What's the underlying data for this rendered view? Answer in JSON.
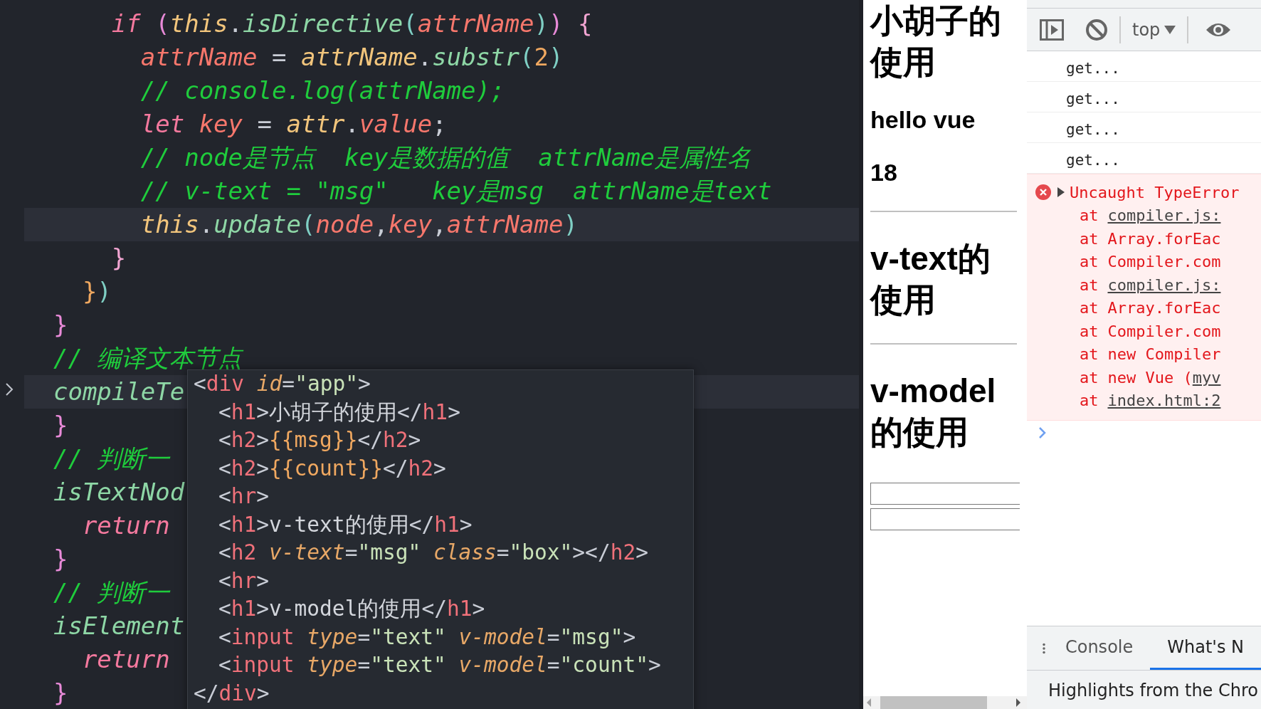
{
  "editor": {
    "lines": [
      {
        "children": [
          {
            "children": [
              {
                "highlighted": false,
                "tokens": [
                  {
                    "t": "if",
                    "kind": "kw"
                  },
                  {
                    "t": " (",
                    "kind": "br"
                  },
                  {
                    "t": "this",
                    "kind": "obj"
                  },
                  {
                    "t": ".",
                    "kind": "p"
                  },
                  {
                    "t": "isDirective",
                    "kind": "fn"
                  },
                  {
                    "t": "(",
                    "kind": "br2"
                  },
                  {
                    "t": "attrName",
                    "kind": "var"
                  },
                  {
                    "t": ")",
                    "kind": "br2"
                  },
                  {
                    "t": ")",
                    "kind": "br"
                  },
                  {
                    "t": " {",
                    "kind": "br3"
                  }
                ],
                "children": [
                  {
                    "highlighted": false,
                    "tokens": [
                      {
                        "t": "attrName",
                        "kind": "var"
                      },
                      {
                        "t": " = ",
                        "kind": "p"
                      },
                      {
                        "t": "attrName",
                        "kind": "obj"
                      },
                      {
                        "t": ".",
                        "kind": "p"
                      },
                      {
                        "t": "substr",
                        "kind": "fn"
                      },
                      {
                        "t": "(",
                        "kind": "br2"
                      },
                      {
                        "t": "2",
                        "kind": "num"
                      },
                      {
                        "t": ")",
                        "kind": "br2"
                      }
                    ]
                  },
                  {
                    "highlighted": false,
                    "tokens": [
                      {
                        "t": "// console.log(attrName);",
                        "kind": "cm"
                      }
                    ]
                  },
                  {
                    "highlighted": false,
                    "tokens": [
                      {
                        "t": "let ",
                        "kind": "kw"
                      },
                      {
                        "t": "key",
                        "kind": "var"
                      },
                      {
                        "t": " = ",
                        "kind": "p"
                      },
                      {
                        "t": "attr",
                        "kind": "obj"
                      },
                      {
                        "t": ".",
                        "kind": "p"
                      },
                      {
                        "t": "value",
                        "kind": "var"
                      },
                      {
                        "t": ";",
                        "kind": "p"
                      }
                    ]
                  },
                  {
                    "highlighted": false,
                    "tokens": [
                      {
                        "t": "// node是节点  key是数据的值  attrName是属性名",
                        "kind": "cm"
                      }
                    ]
                  },
                  {
                    "highlighted": false,
                    "tokens": [
                      {
                        "t": "// v-text = \"msg\"   key是msg  attrName是text",
                        "kind": "cm"
                      }
                    ]
                  },
                  {
                    "highlighted": true,
                    "tokens": [
                      {
                        "t": "this",
                        "kind": "obj"
                      },
                      {
                        "t": ".",
                        "kind": "p"
                      },
                      {
                        "t": "update",
                        "kind": "fn"
                      },
                      {
                        "t": "(",
                        "kind": "br2"
                      },
                      {
                        "t": "node",
                        "kind": "var"
                      },
                      {
                        "t": ",",
                        "kind": "p"
                      },
                      {
                        "t": "key",
                        "kind": "var"
                      },
                      {
                        "t": ",",
                        "kind": "p"
                      },
                      {
                        "t": "attrName",
                        "kind": "var"
                      },
                      {
                        "t": ")",
                        "kind": "br2"
                      }
                    ]
                  }
                ]
              },
              {
                "highlighted": false,
                "tokens": [
                  {
                    "t": "}",
                    "kind": "br3"
                  }
                ]
              }
            ]
          },
          {
            "highlighted": false,
            "tokens": [
              {
                "t": "}",
                "kind": "num"
              },
              {
                "t": ")",
                "kind": "br2"
              }
            ]
          }
        ]
      },
      {
        "highlighted": false,
        "tokens": [
          {
            "t": "}",
            "kind": "br"
          }
        ]
      },
      {
        "highlighted": false,
        "tokens": [
          {
            "t": "// 编译文本节点",
            "kind": "cm"
          }
        ]
      },
      {
        "highlighted": true,
        "tokens": [
          {
            "t": "compileTe",
            "kind": "fn"
          }
        ]
      },
      {
        "highlighted": false,
        "tokens": [
          {
            "t": "}",
            "kind": "br"
          }
        ]
      },
      {
        "highlighted": false,
        "tokens": [
          {
            "t": "// 判断一",
            "kind": "cm"
          }
        ]
      },
      {
        "highlighted": false,
        "tokens": [
          {
            "t": "isTextNod",
            "kind": "fn"
          }
        ],
        "children": [
          {
            "highlighted": false,
            "tokens": [
              {
                "t": "return",
                "kind": "kw"
              }
            ]
          }
        ]
      },
      {
        "highlighted": false,
        "tokens": [
          {
            "t": "}",
            "kind": "br"
          }
        ]
      },
      {
        "highlighted": false,
        "tokens": [
          {
            "t": "// 判断一",
            "kind": "cm"
          }
        ]
      },
      {
        "highlighted": false,
        "tokens": [
          {
            "t": "isElement",
            "kind": "fn"
          }
        ],
        "children": [
          {
            "highlighted": false,
            "tokens": [
              {
                "t": "return",
                "kind": "kw"
              }
            ]
          }
        ]
      },
      {
        "highlighted": false,
        "tokens": [
          {
            "t": "}",
            "kind": "br"
          }
        ]
      }
    ]
  },
  "html_popup": {
    "lines": [
      {
        "tokens": [
          {
            "t": "<",
            "kind": "p"
          },
          {
            "t": "div",
            "kind": "tag"
          },
          {
            "t": " id",
            "kind": "attr"
          },
          {
            "t": "=",
            "kind": "p"
          },
          {
            "t": "\"app\"",
            "kind": "str"
          },
          {
            "t": ">",
            "kind": "p"
          }
        ],
        "children": [
          {
            "tokens": [
              {
                "t": "<",
                "kind": "p"
              },
              {
                "t": "h1",
                "kind": "tag"
              },
              {
                "t": ">",
                "kind": "p"
              },
              {
                "t": "小胡子的使用",
                "kind": "txt"
              },
              {
                "t": "</",
                "kind": "p"
              },
              {
                "t": "h1",
                "kind": "tag"
              },
              {
                "t": ">",
                "kind": "p"
              }
            ]
          },
          {
            "tokens": [
              {
                "t": "<",
                "kind": "p"
              },
              {
                "t": "h2",
                "kind": "tag"
              },
              {
                "t": ">",
                "kind": "p"
              },
              {
                "t": "{{msg}}",
                "kind": "interp"
              },
              {
                "t": "</",
                "kind": "p"
              },
              {
                "t": "h2",
                "kind": "tag"
              },
              {
                "t": ">",
                "kind": "p"
              }
            ]
          },
          {
            "tokens": [
              {
                "t": "<",
                "kind": "p"
              },
              {
                "t": "h2",
                "kind": "tag"
              },
              {
                "t": ">",
                "kind": "p"
              },
              {
                "t": "{{count}}",
                "kind": "interp"
              },
              {
                "t": "</",
                "kind": "p"
              },
              {
                "t": "h2",
                "kind": "tag"
              },
              {
                "t": ">",
                "kind": "p"
              }
            ]
          },
          {
            "tokens": [
              {
                "t": "<",
                "kind": "p"
              },
              {
                "t": "hr",
                "kind": "tag"
              },
              {
                "t": ">",
                "kind": "p"
              }
            ]
          },
          {
            "tokens": [
              {
                "t": "<",
                "kind": "p"
              },
              {
                "t": "h1",
                "kind": "tag"
              },
              {
                "t": ">",
                "kind": "p"
              },
              {
                "t": "v-text的使用",
                "kind": "txt"
              },
              {
                "t": "</",
                "kind": "p"
              },
              {
                "t": "h1",
                "kind": "tag"
              },
              {
                "t": ">",
                "kind": "p"
              }
            ]
          },
          {
            "tokens": [
              {
                "t": "<",
                "kind": "p"
              },
              {
                "t": "h2",
                "kind": "tag"
              },
              {
                "t": " v-text",
                "kind": "attr"
              },
              {
                "t": "=",
                "kind": "p"
              },
              {
                "t": "\"msg\"",
                "kind": "str"
              },
              {
                "t": " class",
                "kind": "attr"
              },
              {
                "t": "=",
                "kind": "p"
              },
              {
                "t": "\"box\"",
                "kind": "str"
              },
              {
                "t": "></",
                "kind": "p"
              },
              {
                "t": "h2",
                "kind": "tag"
              },
              {
                "t": ">",
                "kind": "p"
              }
            ]
          },
          {
            "tokens": [
              {
                "t": "<",
                "kind": "p"
              },
              {
                "t": "hr",
                "kind": "tag"
              },
              {
                "t": ">",
                "kind": "p"
              }
            ]
          },
          {
            "tokens": [
              {
                "t": "<",
                "kind": "p"
              },
              {
                "t": "h1",
                "kind": "tag"
              },
              {
                "t": ">",
                "kind": "p"
              },
              {
                "t": "v-model的使用",
                "kind": "txt"
              },
              {
                "t": "</",
                "kind": "p"
              },
              {
                "t": "h1",
                "kind": "tag"
              },
              {
                "t": ">",
                "kind": "p"
              }
            ]
          },
          {
            "tokens": [
              {
                "t": "<",
                "kind": "p"
              },
              {
                "t": "input",
                "kind": "tag"
              },
              {
                "t": " type",
                "kind": "attr"
              },
              {
                "t": "=",
                "kind": "p"
              },
              {
                "t": "\"text\"",
                "kind": "str"
              },
              {
                "t": " v-model",
                "kind": "attr"
              },
              {
                "t": "=",
                "kind": "p"
              },
              {
                "t": "\"msg\"",
                "kind": "str"
              },
              {
                "t": ">",
                "kind": "p"
              }
            ]
          },
          {
            "tokens": [
              {
                "t": "<",
                "kind": "p"
              },
              {
                "t": "input",
                "kind": "tag"
              },
              {
                "t": " type",
                "kind": "attr"
              },
              {
                "t": "=",
                "kind": "p"
              },
              {
                "t": "\"text\"",
                "kind": "str"
              },
              {
                "t": " v-model",
                "kind": "attr"
              },
              {
                "t": "=",
                "kind": "p"
              },
              {
                "t": "\"count\"",
                "kind": "str"
              },
              {
                "t": ">",
                "kind": "p"
              }
            ]
          }
        ]
      },
      {
        "tokens": [
          {
            "t": "</",
            "kind": "p"
          },
          {
            "t": "div",
            "kind": "tag"
          },
          {
            "t": ">",
            "kind": "p"
          }
        ]
      }
    ]
  },
  "page_preview": {
    "items": [
      {
        "kind": "h1",
        "text": "小胡子的使用"
      },
      {
        "kind": "h2",
        "text": "hello vue"
      },
      {
        "kind": "h2",
        "text": "18"
      },
      {
        "kind": "hr"
      },
      {
        "kind": "h1",
        "text": "v-text的使用"
      },
      {
        "kind": "hr"
      },
      {
        "kind": "h1",
        "text": "v-model的使用"
      },
      {
        "kind": "input"
      },
      {
        "kind": "input"
      }
    ]
  },
  "devtools": {
    "toolbar": {
      "context": "top"
    },
    "messages": [
      {
        "kind": "log",
        "text": "get..."
      },
      {
        "kind": "log",
        "text": "get..."
      },
      {
        "kind": "log",
        "text": "get..."
      },
      {
        "kind": "log",
        "text": "get..."
      },
      {
        "kind": "error",
        "text": "Uncaught TypeError",
        "stack": [
          {
            "at": "at",
            "parts": [
              {
                "t": "compiler.js:",
                "link": true
              }
            ]
          },
          {
            "at": "at",
            "parts": [
              {
                "t": "Array.forEac",
                "link": false
              }
            ]
          },
          {
            "at": "at",
            "parts": [
              {
                "t": "Compiler.com",
                "link": false
              }
            ]
          },
          {
            "at": "at",
            "parts": [
              {
                "t": "compiler.js:",
                "link": true
              }
            ]
          },
          {
            "at": "at",
            "parts": [
              {
                "t": "Array.forEac",
                "link": false
              }
            ]
          },
          {
            "at": "at",
            "parts": [
              {
                "t": "Compiler.com",
                "link": false
              }
            ]
          },
          {
            "at": "at",
            "parts": [
              {
                "t": "new Compiler",
                "link": false
              }
            ]
          },
          {
            "at": "at",
            "parts": [
              {
                "t": "new Vue (",
                "link": false
              },
              {
                "t": "myv",
                "link": true
              }
            ]
          },
          {
            "at": "at",
            "parts": [
              {
                "t": "index.html:2",
                "link": true
              }
            ]
          }
        ]
      }
    ],
    "drawer": {
      "tabs": [
        {
          "label": "Console",
          "selected": false
        },
        {
          "label": "What's N",
          "selected": true
        }
      ],
      "content": "Highlights from the Chro"
    }
  }
}
